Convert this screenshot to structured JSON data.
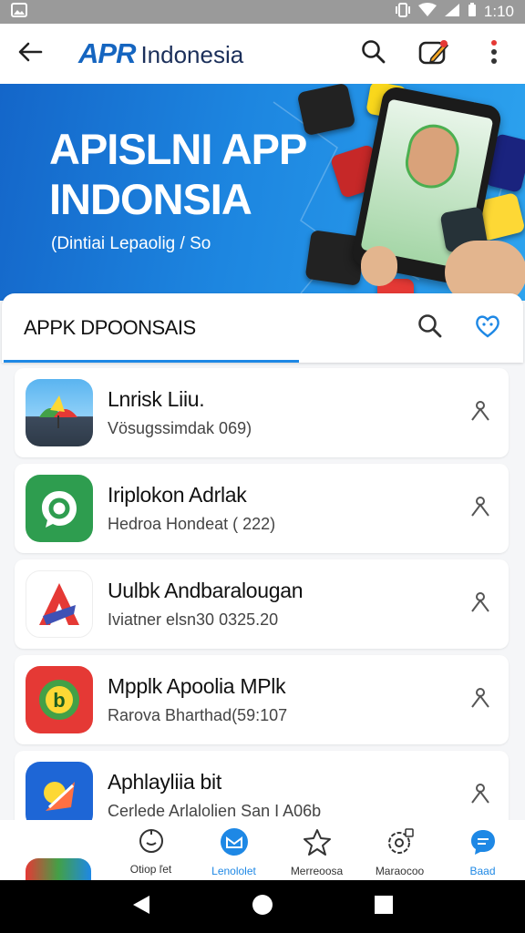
{
  "status_bar": {
    "time": "1:10"
  },
  "app_bar": {
    "logo": "APR",
    "title": "Indonesia"
  },
  "banner": {
    "title_line1": "APISLNI APP",
    "title_line2": "INDONSIA",
    "subtitle": "(Dintiai Lepaolig / So"
  },
  "section": {
    "title": "APPK DPOONSAIS"
  },
  "apps": [
    {
      "name": "Lnrisk Liiu.",
      "meta": "Vösugssimdak 069)"
    },
    {
      "name": "Iriplokon Adrlak",
      "meta": "Hedroa Hondeat ( 222)"
    },
    {
      "name": "Uulbk Andbaralougan",
      "meta": "Iviatner elsn30 0325.20"
    },
    {
      "name": "Mpplk Apoolia MPlk",
      "meta": "Rarova Bharthad(59:107"
    },
    {
      "name": "Aphlayliia bit",
      "meta": "Cerlede Arlalolien San I A06b"
    }
  ],
  "bottom_nav": [
    {
      "label": "Otiop ľet"
    },
    {
      "label": "Lenololet"
    },
    {
      "label": "Merreoosa"
    },
    {
      "label": "Maraocoo"
    },
    {
      "label": "Baad"
    }
  ],
  "colors": {
    "accent": "#1e88e5",
    "banner": "#1d86e0"
  }
}
